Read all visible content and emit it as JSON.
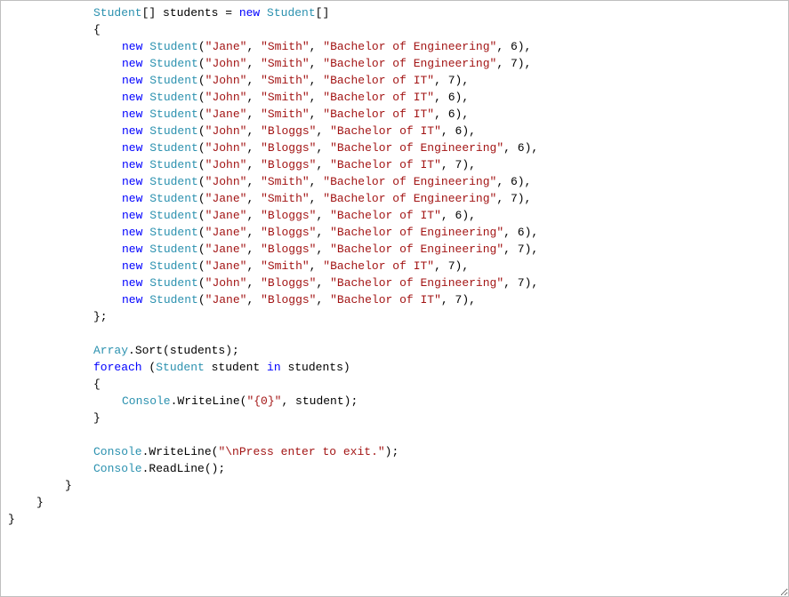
{
  "code": {
    "decl_pre": "Student",
    "decl_mid": "[] students = ",
    "decl_new": "new",
    "decl_post": " Student[]",
    "open_brace": "{",
    "close_brace_semi": "};",
    "students": [
      {
        "first": "\"Jane\"",
        "last": "\"Smith\"",
        "deg": "\"Bachelor of Engineering\"",
        "n": "6"
      },
      {
        "first": "\"John\"",
        "last": "\"Smith\"",
        "deg": "\"Bachelor of Engineering\"",
        "n": "7"
      },
      {
        "first": "\"John\"",
        "last": "\"Smith\"",
        "deg": "\"Bachelor of IT\"",
        "n": "7"
      },
      {
        "first": "\"John\"",
        "last": "\"Smith\"",
        "deg": "\"Bachelor of IT\"",
        "n": "6"
      },
      {
        "first": "\"Jane\"",
        "last": "\"Smith\"",
        "deg": "\"Bachelor of IT\"",
        "n": "6"
      },
      {
        "first": "\"John\"",
        "last": "\"Bloggs\"",
        "deg": "\"Bachelor of IT\"",
        "n": "6"
      },
      {
        "first": "\"John\"",
        "last": "\"Bloggs\"",
        "deg": "\"Bachelor of Engineering\"",
        "n": "6"
      },
      {
        "first": "\"John\"",
        "last": "\"Bloggs\"",
        "deg": "\"Bachelor of IT\"",
        "n": "7"
      },
      {
        "first": "\"John\"",
        "last": "\"Smith\"",
        "deg": "\"Bachelor of Engineering\"",
        "n": "6"
      },
      {
        "first": "\"Jane\"",
        "last": "\"Smith\"",
        "deg": "\"Bachelor of Engineering\"",
        "n": "7"
      },
      {
        "first": "\"Jane\"",
        "last": "\"Bloggs\"",
        "deg": "\"Bachelor of IT\"",
        "n": "6"
      },
      {
        "first": "\"Jane\"",
        "last": "\"Bloggs\"",
        "deg": "\"Bachelor of Engineering\"",
        "n": "6"
      },
      {
        "first": "\"Jane\"",
        "last": "\"Bloggs\"",
        "deg": "\"Bachelor of Engineering\"",
        "n": "7"
      },
      {
        "first": "\"Jane\"",
        "last": "\"Smith\"",
        "deg": "\"Bachelor of IT\"",
        "n": "7"
      },
      {
        "first": "\"John\"",
        "last": "\"Bloggs\"",
        "deg": "\"Bachelor of Engineering\"",
        "n": "7"
      },
      {
        "first": "\"Jane\"",
        "last": "\"Bloggs\"",
        "deg": "\"Bachelor of IT\"",
        "n": "7"
      }
    ],
    "new_kw": "new",
    "student_ctor_pre": " Student(",
    "comma": ", ",
    "ctor_close": "),",
    "sort_line_pre": "Array",
    "sort_line_post": ".Sort(students);",
    "foreach_kw": "foreach",
    "foreach_open": " (",
    "student_type": "Student",
    "foreach_mid": " student ",
    "in_kw": "in",
    "foreach_post": " students)",
    "console_type": "Console",
    "writeline_call": ".WriteLine(",
    "writeline_fmt": "\"{0}\"",
    "writeline_post": ", student);",
    "brace_open": "{",
    "brace_close": "}",
    "press_enter_str": "\"\\nPress enter to exit.\"",
    "writeline_close": ");",
    "readline_call": ".ReadLine();"
  }
}
